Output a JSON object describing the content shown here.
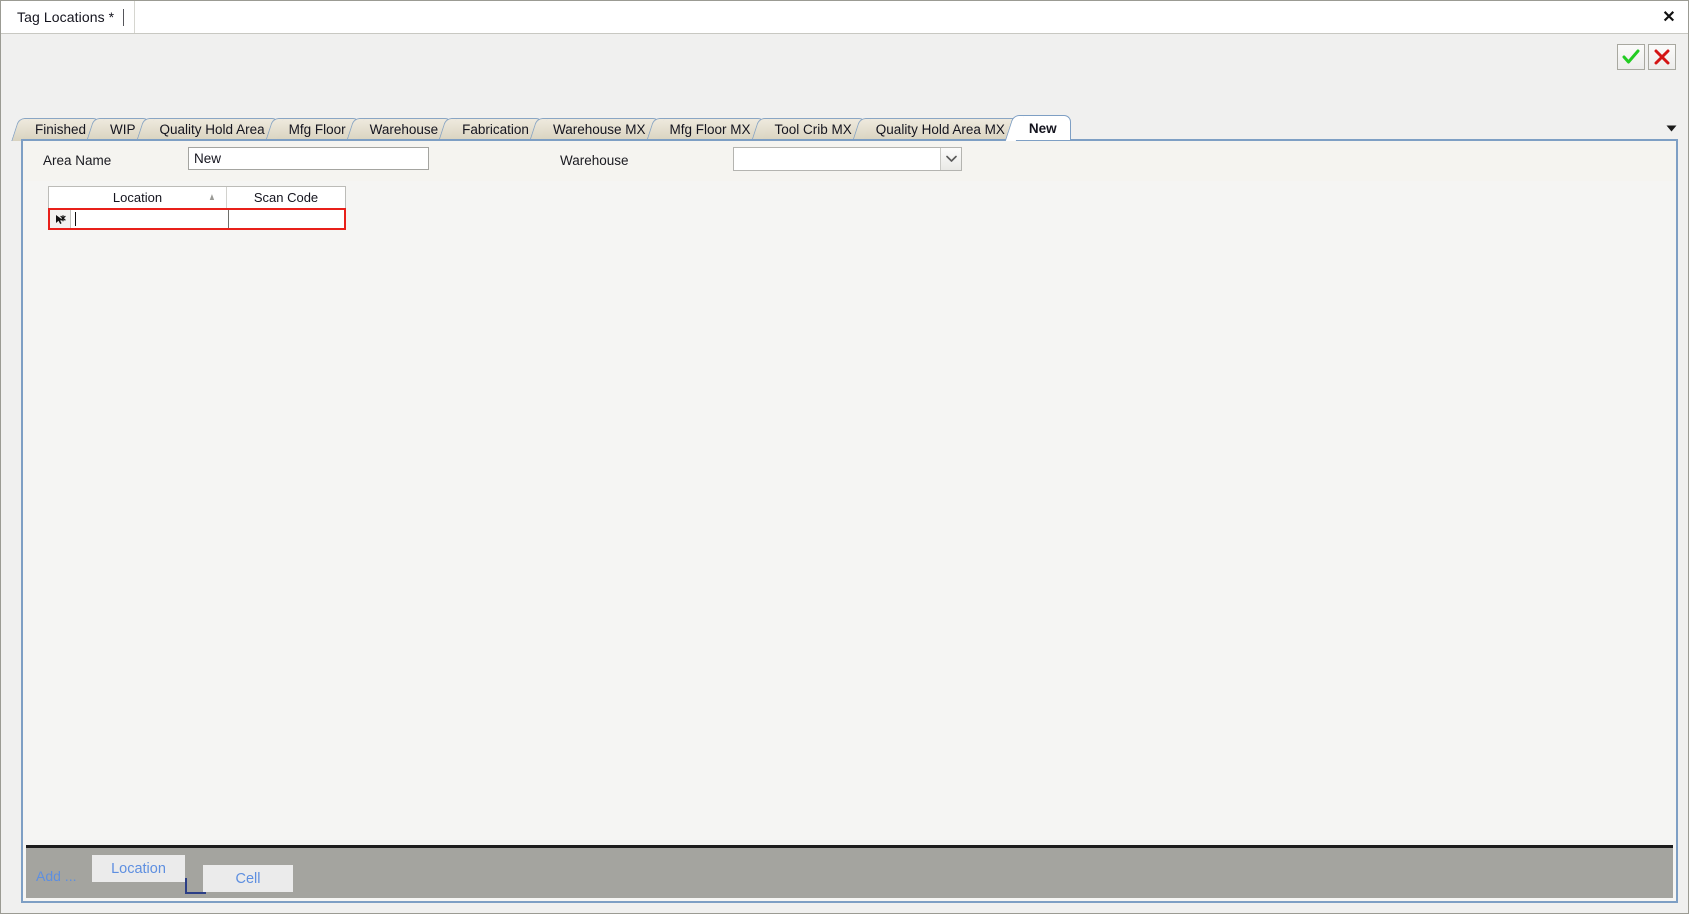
{
  "window": {
    "document_tab_title": "Tag Locations *",
    "close_icon": "close-icon"
  },
  "commit_bar": {
    "ok_icon": "checkmark-icon",
    "cancel_icon": "red-x-icon",
    "ok_color": "#22cc22",
    "cancel_color": "#d41414"
  },
  "tabs": {
    "items": [
      {
        "label": "Finished",
        "active": false
      },
      {
        "label": "WIP",
        "active": false
      },
      {
        "label": "Quality Hold Area",
        "active": false
      },
      {
        "label": "Mfg Floor",
        "active": false
      },
      {
        "label": "Warehouse",
        "active": false
      },
      {
        "label": "Fabrication",
        "active": false
      },
      {
        "label": "Warehouse MX",
        "active": false
      },
      {
        "label": "Mfg Floor MX",
        "active": false
      },
      {
        "label": "Tool Crib MX",
        "active": false
      },
      {
        "label": "Quality Hold Area MX",
        "active": false
      },
      {
        "label": "New",
        "active": true
      }
    ],
    "overflow_icon": "chevron-down-icon"
  },
  "form": {
    "area_name_label": "Area Name",
    "area_name_value": "New",
    "warehouse_label": "Warehouse",
    "warehouse_value": "",
    "warehouse_dropdown_icon": "chevron-down-icon"
  },
  "grid": {
    "columns": [
      {
        "label": "Location",
        "sort": "ascending",
        "sort_icon": "sort-ascending-icon"
      },
      {
        "label": "Scan Code",
        "sort": "none"
      }
    ],
    "rows": [],
    "new_row": {
      "marker_icon": "new-row-asterisk-icon",
      "location": "",
      "scan_code": "",
      "validation_border_color": "#e8201a",
      "focused_cell": "location"
    }
  },
  "bottom_bar": {
    "add_label": "Add ...",
    "location_button": "Location",
    "cell_button": "Cell",
    "text_color": "#5e8fe0",
    "bar_color": "#a4a49f"
  }
}
